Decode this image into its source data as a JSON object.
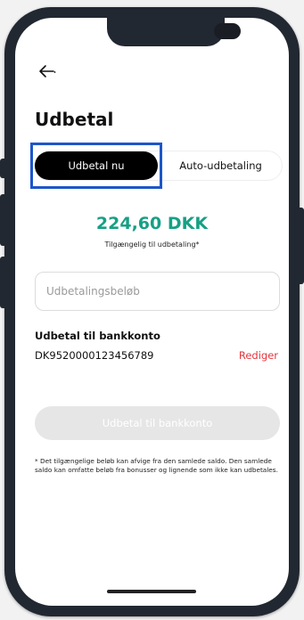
{
  "header": {
    "back_icon": "arrow-left-icon",
    "title": "Udbetal"
  },
  "tabs": [
    {
      "label": "Udbetal nu",
      "active": true
    },
    {
      "label": "Auto-udbetaling",
      "active": false
    }
  ],
  "balance": {
    "amount": "224,60 DKK",
    "caption": "Tilgængelig til udbetaling*"
  },
  "amount_input": {
    "placeholder": "Udbetalingsbeløb"
  },
  "bank": {
    "label": "Udbetal til bankkonto",
    "account": "DK9520000123456789",
    "edit_label": "Rediger"
  },
  "submit_button": {
    "label": "Udbetal til bankkonto",
    "enabled": false
  },
  "footnote": "* Det tilgængelige beløb kan afvige fra den samlede saldo. Den samlede saldo kan omfatte beløb fra bonusser og lignende som ikke kan udbetales.",
  "colors": {
    "accent_amount": "#17a085",
    "edit_link": "#e5363d",
    "highlight": "#1e56c9"
  }
}
